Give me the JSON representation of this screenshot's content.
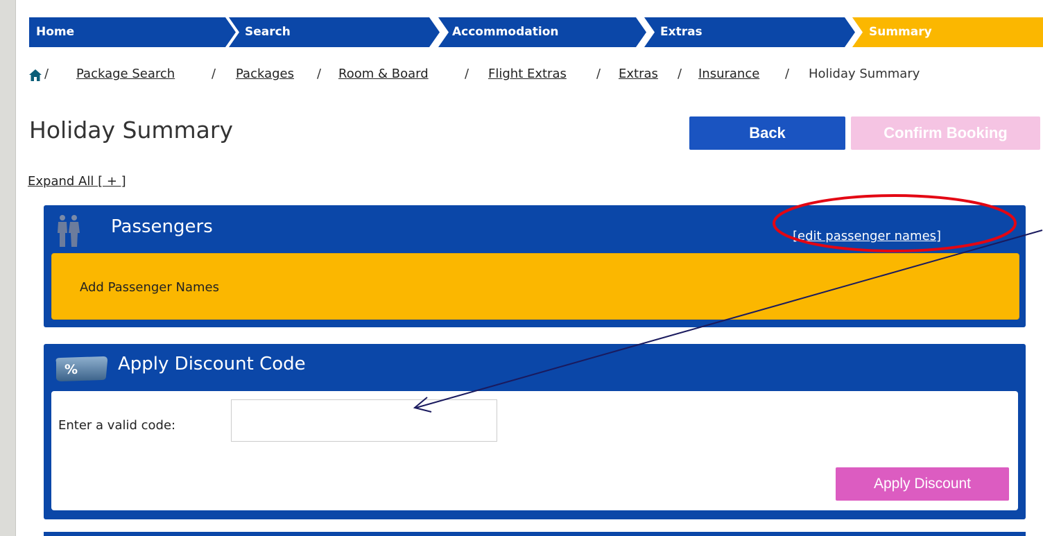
{
  "steps": [
    {
      "label": "Home",
      "state": "done"
    },
    {
      "label": "Search",
      "state": "done"
    },
    {
      "label": "Accommodation",
      "state": "done"
    },
    {
      "label": "Extras",
      "state": "done"
    },
    {
      "label": "Summary",
      "state": "current"
    }
  ],
  "colors": {
    "step_blue": "#0b47a8",
    "step_current": "#fbb700",
    "back_button": "#1a54c1",
    "confirm_button_disabled": "#f5c4e3",
    "apply_button": "#dc5cc1",
    "annotation_red": "#e30613",
    "annotation_arrow": "#1a1a5e"
  },
  "breadcrumb": {
    "home_icon": "home-icon",
    "separator": "/",
    "links": [
      "Package Search",
      "Packages",
      "Room & Board",
      "Flight Extras",
      "Extras",
      "Insurance"
    ],
    "current": "Holiday Summary"
  },
  "page": {
    "title": "Holiday Summary",
    "back_label": "Back",
    "confirm_label": "Confirm Booking",
    "expand_all": "Expand All [ + ]"
  },
  "passengers": {
    "icon": "passengers-icon",
    "title": "Passengers",
    "edit_link": "[edit passenger names]",
    "body_text": "Add Passenger Names"
  },
  "discount": {
    "icon": "discount-tag-icon",
    "icon_text": "%",
    "title": "Apply Discount Code",
    "field_label": "Enter a valid code:",
    "field_value": "",
    "button_label": "Apply Discount"
  }
}
